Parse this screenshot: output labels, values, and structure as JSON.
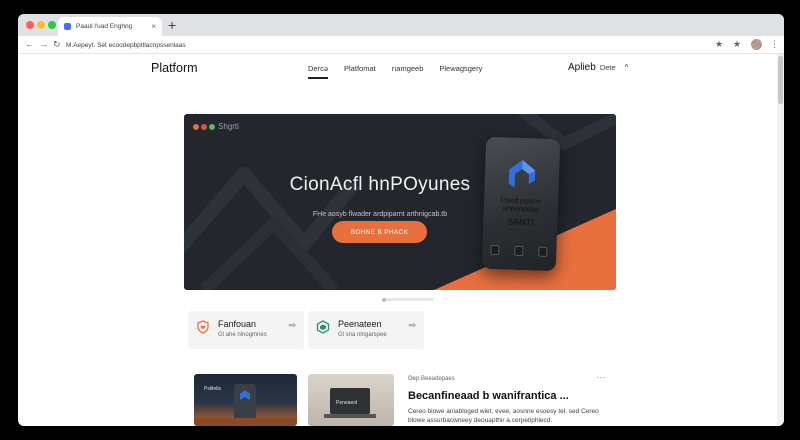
{
  "browser": {
    "tab_title": "Paaul l'uad Enghng",
    "new_tab_label": "+",
    "tab_close_label": "×",
    "address": "M.Aepeyt. Set ecoodepbpttlacnpssenlaas",
    "back_glyph": "←",
    "forward_glyph": "→",
    "reload_glyph": "↻",
    "bookmark_glyph": "★",
    "extension_glyph": "★",
    "menu_glyph": "⋮"
  },
  "site": {
    "brand": "Platform",
    "nav": [
      {
        "label": "Dercə",
        "active": true
      },
      {
        "label": "Platfomat",
        "active": false
      },
      {
        "label": "rıamgeeb",
        "active": false
      },
      {
        "label": "Plewagsgery",
        "active": false
      }
    ],
    "account_name": "Aplieb",
    "account_sub": "Dete",
    "account_chevron": "^"
  },
  "hero": {
    "logo_text": "Shgrti",
    "title": "CionAcfl hnPOyunes",
    "subtitle": "FHe aosyb flwader ardpiparnt arthnigcab.tb",
    "cta": "BOHNE B PHACK",
    "phone_text_line1": "Pised pgocro",
    "phone_text_line2": "sinpenpolas",
    "phone_text_line3": "SANTI",
    "colors": {
      "accent": "#e8703e",
      "dark": "#23272d",
      "phone_logo": "#2f6fde"
    }
  },
  "cards": [
    {
      "title": "Fanfouan",
      "subtitle": "Gl ahe nlnogmnes",
      "icon": "shield-heart-icon",
      "arrow": "⇨",
      "icon_color": "#e8703e"
    },
    {
      "title": "Peenateen",
      "subtitle": "Gl sna nlngarspee",
      "icon": "hexagon-icon",
      "arrow": "⇨",
      "icon_color": "#2f8f73"
    }
  ],
  "article": {
    "meta": "Oep Beeadepaes",
    "title": "Becanfineaad b wanifrantica ...",
    "description": "Cereo biowe aniabloged wiet, evee, aosnne esoesy tel, sed Cereo blowe assurbacwneey deouapthir a.cerpetiphlecd.",
    "more": "···",
    "thumb1_text": "Pslitelis",
    "thumb2_text": "Peneaeol"
  }
}
